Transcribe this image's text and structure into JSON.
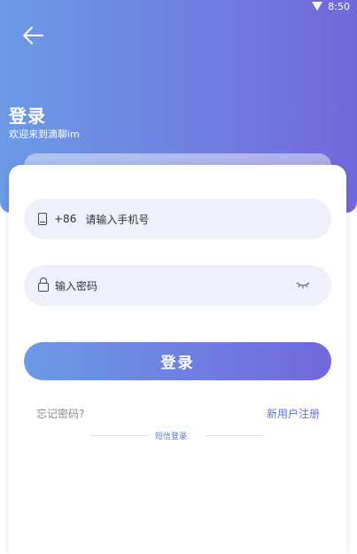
{
  "status_bar": {
    "time": "8:50"
  },
  "header": {
    "title": "登录",
    "subtitle": "欢迎来到滴聊im"
  },
  "form": {
    "country_code": "+86",
    "phone_placeholder": "请输入手机号",
    "password_placeholder": "输入密码",
    "login_label": "登录"
  },
  "links": {
    "forgot_password": "忘记密码?",
    "register": "新用户注册",
    "sms_login": "短信登录"
  },
  "colors": {
    "gradient_start": "#6b9ae6",
    "gradient_end": "#7168dc",
    "field_bg": "#eef0fb",
    "link_blue": "#5a73dc"
  }
}
